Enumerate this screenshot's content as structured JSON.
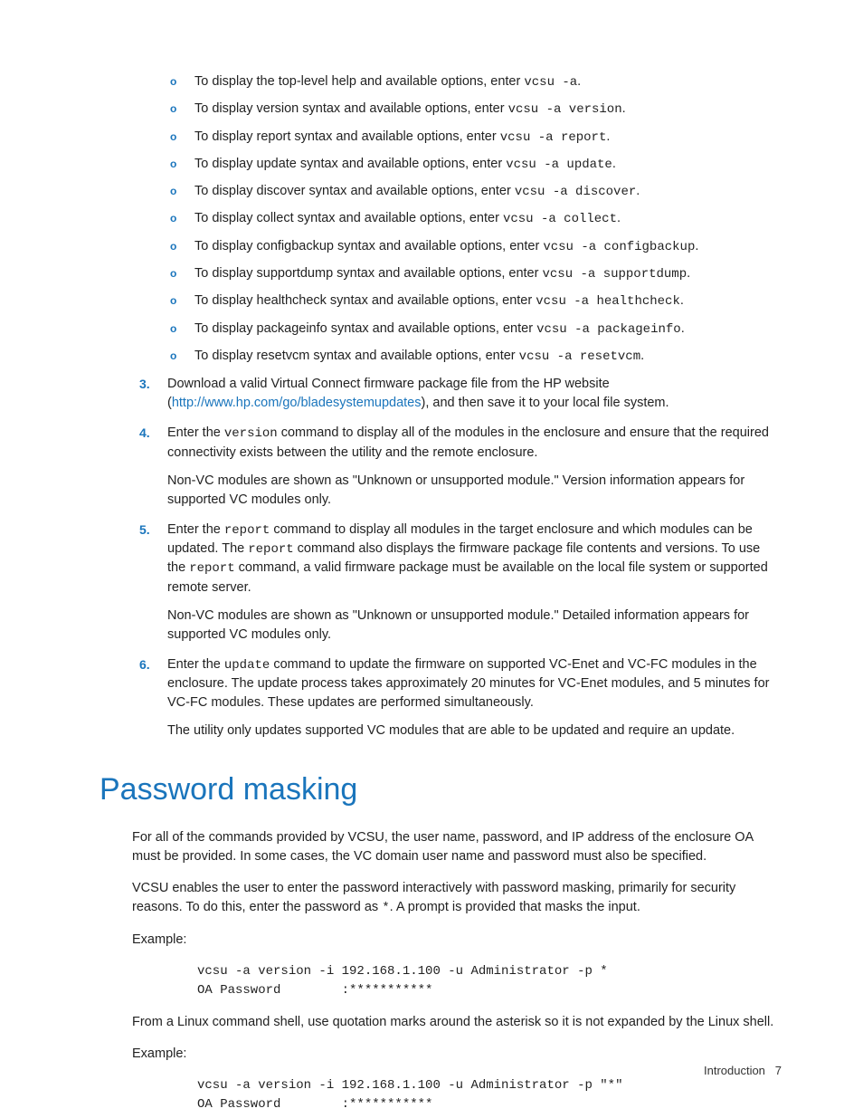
{
  "sublist": [
    {
      "prefix": "To display the top-level help and available options, enter ",
      "code": "vcsu -a",
      "suffix": "."
    },
    {
      "prefix": "To display version syntax and available options, enter ",
      "code": "vcsu -a version",
      "suffix": "."
    },
    {
      "prefix": "To display report syntax and available options, enter ",
      "code": "vcsu -a report",
      "suffix": "."
    },
    {
      "prefix": "To display update syntax and available options, enter ",
      "code": "vcsu -a update",
      "suffix": "."
    },
    {
      "prefix": "To display discover syntax and available options, enter ",
      "code": "vcsu -a discover",
      "suffix": "."
    },
    {
      "prefix": "To display collect syntax and available options, enter ",
      "code": "vcsu -a collect",
      "suffix": "."
    },
    {
      "prefix": "To display configbackup syntax and available options, enter ",
      "code": "vcsu -a configbackup",
      "suffix": "."
    },
    {
      "prefix": "To display supportdump syntax and available options, enter ",
      "code": "vcsu -a supportdump",
      "suffix": "."
    },
    {
      "prefix": "To display healthcheck syntax and available options, enter ",
      "code": "vcsu -a healthcheck",
      "suffix": "."
    },
    {
      "prefix": "To display packageinfo syntax and available options, enter ",
      "code": "vcsu -a packageinfo",
      "suffix": "."
    },
    {
      "prefix": "To display resetvcm syntax and available options, enter ",
      "code": "vcsu -a resetvcm",
      "suffix": "."
    }
  ],
  "steps": {
    "s3": {
      "num": "3.",
      "t1": "Download a valid Virtual Connect firmware package file from the HP website (",
      "link": "http://www.hp.com/go/bladesystemupdates",
      "t2": "), and then save it to your local file system."
    },
    "s4": {
      "num": "4.",
      "t1": "Enter the ",
      "c1": "version",
      "t2": " command to display all of the modules in the enclosure and ensure that the required connectivity exists between the utility and the remote enclosure.",
      "p2": "Non-VC modules are shown as \"Unknown or unsupported module.\" Version information appears for supported VC modules only."
    },
    "s5": {
      "num": "5.",
      "t1": "Enter the ",
      "c1": "report",
      "t2": " command to display all modules in the target enclosure and which modules can be updated. The ",
      "c2": "report",
      "t3": " command also displays the firmware package file contents and versions. To use the ",
      "c3": "report",
      "t4": " command, a valid firmware package must be available on the local file system or supported remote server.",
      "p2": "Non-VC modules are shown as \"Unknown or unsupported module.\" Detailed information appears for supported VC modules only."
    },
    "s6": {
      "num": "6.",
      "t1": "Enter the ",
      "c1": "update",
      "t2": " command to update the firmware on supported VC-Enet and VC-FC modules in the enclosure. The update process takes approximately 20 minutes for VC-Enet modules, and 5 minutes for VC-FC modules. These updates are performed simultaneously.",
      "p2": "The utility only updates supported VC modules that are able to be updated and require an update."
    }
  },
  "section_title": "Password masking",
  "pm": {
    "p1": "For all of the commands provided by VCSU, the user name, password, and IP address of the enclosure OA must be provided. In some cases, the VC domain user name and password must also be specified.",
    "p2a": "VCSU enables the user to enter the password interactively with password masking, primarily for security reasons. To do this, enter the password as ",
    "p2code": "*",
    "p2b": ". A prompt is provided that masks the input.",
    "example_label": "Example:",
    "code1_l1": "vcsu -a version -i 192.168.1.100 -u Administrator -p *",
    "code1_l2": "OA Password        :***********",
    "p3": "From a Linux command shell, use quotation marks around the asterisk so it is not expanded by the Linux shell.",
    "code2_l1": "vcsu -a version -i 192.168.1.100 -u Administrator -p \"*\"",
    "code2_l2": "OA Password        :***********"
  },
  "footer": {
    "section": "Introduction",
    "page": "7"
  },
  "bullet_char": "o"
}
